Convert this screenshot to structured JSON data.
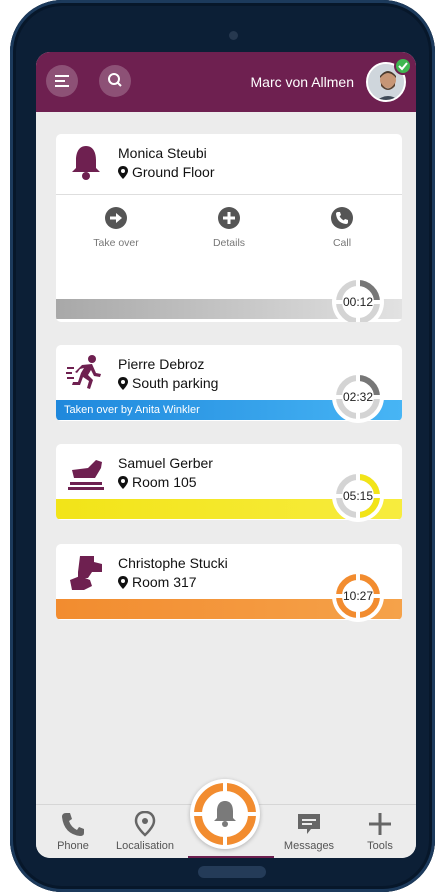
{
  "header": {
    "user_name": "Marc von Allmen",
    "menu_icon": "menu-icon",
    "search_icon": "search-icon",
    "status": "online"
  },
  "alerts": [
    {
      "name": "Monica Steubi",
      "location": "Ground Floor",
      "icon": "bell-icon",
      "timer": "00:12",
      "color": "#b4b4b4",
      "timer_fraction": 0.25,
      "actions": [
        {
          "label": "Take over",
          "icon": "arrow-right-icon"
        },
        {
          "label": "Details",
          "icon": "plus-icon"
        },
        {
          "label": "Call",
          "icon": "phone-icon"
        }
      ]
    },
    {
      "name": "Pierre Debroz",
      "location": "South parking",
      "icon": "running-man-icon",
      "timer": "02:32",
      "color": "#2d9be6",
      "timer_fraction": 0.25,
      "banner": "Taken over by Anita Winkler"
    },
    {
      "name": "Samuel Gerber",
      "location": "Room 105",
      "icon": "shoe-icon",
      "timer": "05:15",
      "color": "#f2e418",
      "timer_fraction": 0.5
    },
    {
      "name": "Christophe Stucki",
      "location": "Room 317",
      "icon": "hand-fall-icon",
      "timer": "10:27",
      "color": "#f28c2f",
      "timer_fraction": 1.0
    }
  ],
  "nav": [
    {
      "label": "Phone",
      "icon": "phone-icon"
    },
    {
      "label": "Localisation",
      "icon": "location-pin-icon"
    },
    {
      "label": "",
      "icon": "alarm-bell-icon",
      "active": true
    },
    {
      "label": "Messages",
      "icon": "message-icon"
    },
    {
      "label": "Tools",
      "icon": "plus-icon"
    }
  ],
  "colors": {
    "brand": "#6e2050",
    "grey": "#b4b4b4",
    "blue": "#2d9be6",
    "yellow": "#f2e418",
    "orange": "#f28c2f"
  }
}
